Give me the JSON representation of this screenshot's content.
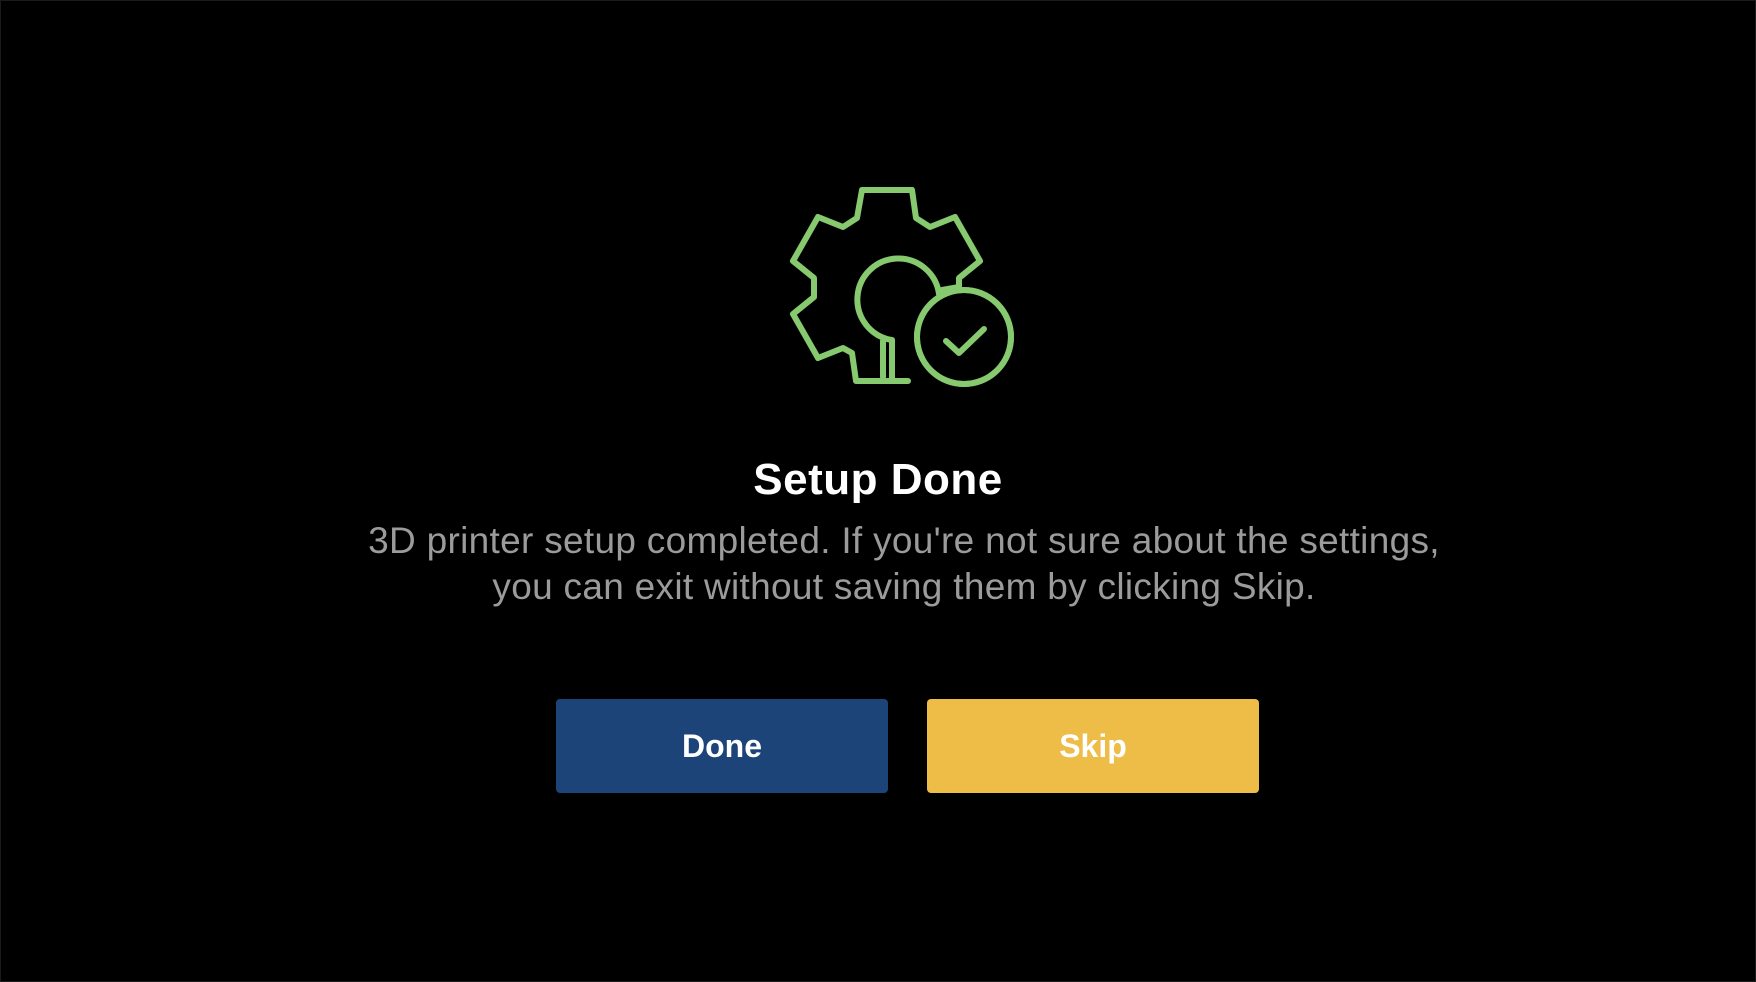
{
  "dialog": {
    "icon": "gear-check-icon",
    "title": "Setup Done",
    "description_line1": "3D printer setup completed. If you're not sure about the settings,",
    "description_line2": "you can exit without saving them by clicking Skip."
  },
  "buttons": {
    "done_label": "Done",
    "skip_label": "Skip"
  },
  "colors": {
    "background": "#000000",
    "icon_green": "#86c96e",
    "title": "#ffffff",
    "description": "#9b9b9b",
    "done_button": "#1c4478",
    "skip_button": "#edbd48"
  }
}
